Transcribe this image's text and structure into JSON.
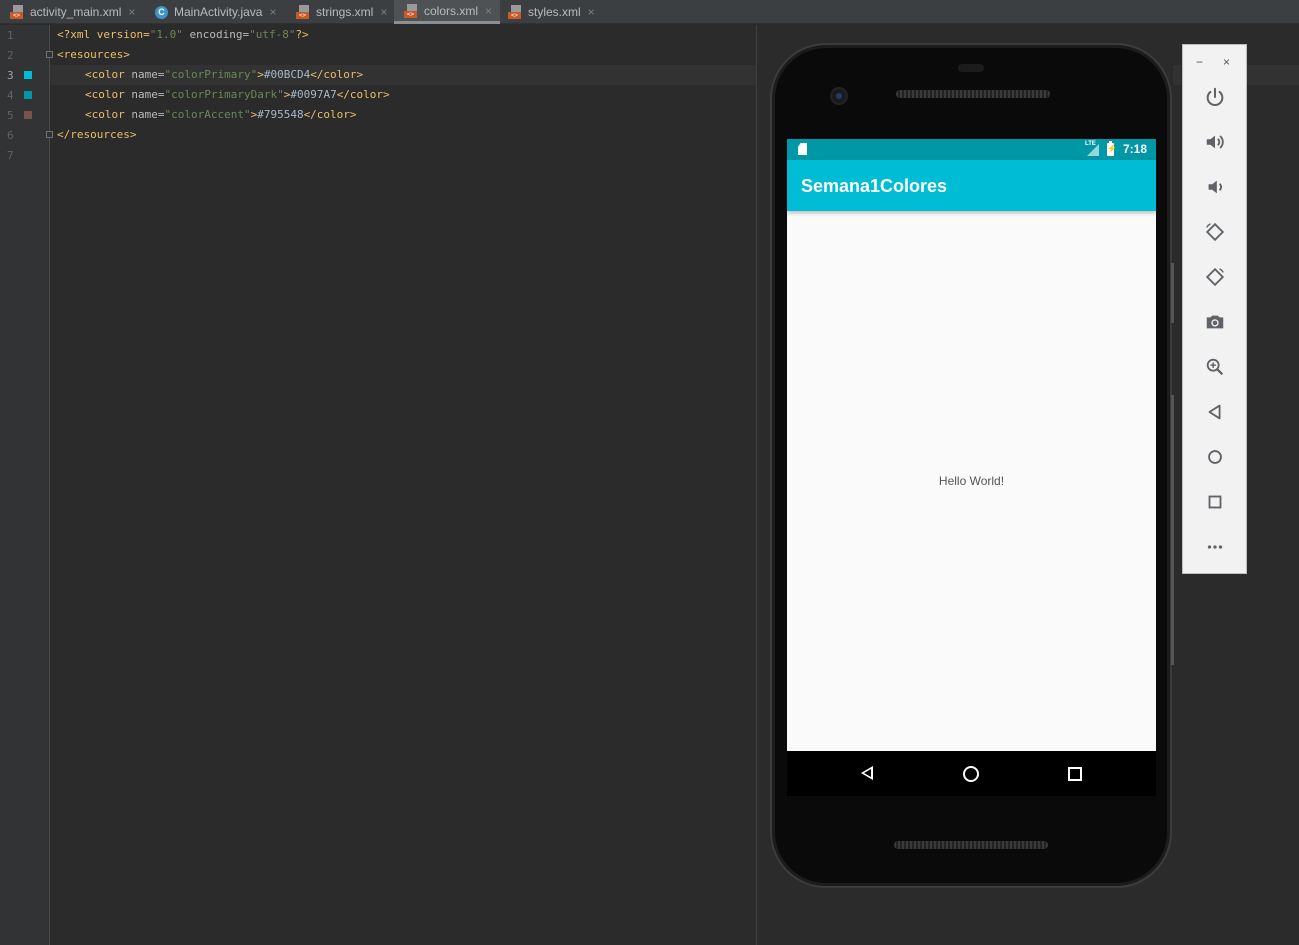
{
  "tabs": [
    {
      "label": "activity_main.xml",
      "icon": "xml-file-icon",
      "active": false
    },
    {
      "label": "MainActivity.java",
      "icon": "java-class-icon",
      "active": false
    },
    {
      "label": "strings.xml",
      "icon": "xml-file-icon",
      "active": false
    },
    {
      "label": "colors.xml",
      "icon": "xml-file-icon",
      "active": true
    },
    {
      "label": "styles.xml",
      "icon": "xml-file-icon",
      "active": false
    }
  ],
  "tab_close_glyph": "×",
  "editor": {
    "line_numbers": [
      "1",
      "2",
      "3",
      "4",
      "5",
      "6",
      "7"
    ],
    "current_line": "3",
    "line1": {
      "p1": "<?xml version=",
      "v1": "\"1.0\"",
      "p2": " encoding=",
      "v2": "\"utf-8\"",
      "p3": "?>"
    },
    "line2": "<resources>",
    "line3": {
      "open": "<color ",
      "attr": "name=",
      "val": "\"colorPrimary\"",
      "gt": ">",
      "text": "#00BCD4",
      "close": "</color>"
    },
    "line4": {
      "open": "<color ",
      "attr": "name=",
      "val": "\"colorPrimaryDark\"",
      "gt": ">",
      "text": "#0097A7",
      "close": "</color>"
    },
    "line5": {
      "open": "<color ",
      "attr": "name=",
      "val": "\"colorAccent\"",
      "gt": ">",
      "text": "#795548",
      "close": "</color>"
    },
    "line6": "</resources>",
    "swatch_colors": [
      "#00BCD4",
      "#0097A7",
      "#795548"
    ]
  },
  "device": {
    "status_time": "7:18",
    "status_network": "LTE",
    "app_title": "Semana1Colores",
    "content_text": "Hello World!",
    "colors": {
      "primary": "#00BCD4",
      "primary_dark": "#0097A7"
    }
  },
  "emulator_panel": {
    "minimize": "−",
    "close": "×",
    "buttons": [
      "power-icon",
      "volume-up-icon",
      "volume-down-icon",
      "rotate-left-icon",
      "rotate-right-icon",
      "camera-icon",
      "zoom-icon",
      "back-icon",
      "home-icon",
      "overview-icon",
      "more-icon"
    ]
  }
}
